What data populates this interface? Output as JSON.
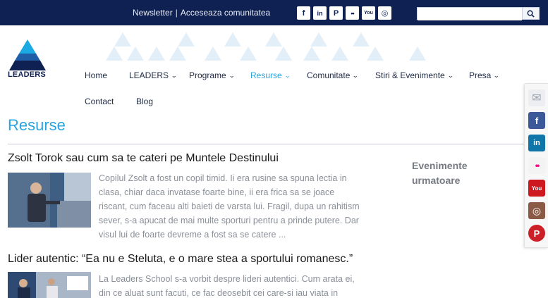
{
  "topbar": {
    "newsletter": "Newsletter",
    "separator": "|",
    "community": "Acceseaza comunitatea",
    "socials": [
      {
        "icon": "facebook-icon",
        "glyph": "f"
      },
      {
        "icon": "linkedin-icon",
        "glyph": "in"
      },
      {
        "icon": "pinterest-icon",
        "glyph": "P"
      },
      {
        "icon": "flickr-icon",
        "glyph": "••"
      },
      {
        "icon": "youtube-icon",
        "glyph": "You"
      },
      {
        "icon": "instagram-icon",
        "glyph": "◎"
      }
    ],
    "search_value": ""
  },
  "logo": {
    "text": "LEADERS",
    "colors": {
      "top": "#1aa9e1",
      "mid": "#1f5fa8",
      "bottom": "#0f2152"
    }
  },
  "nav": {
    "home": "Home",
    "leaders": "LEADERS",
    "programe": "Programe",
    "resurse": "Resurse",
    "comunitate": "Comunitate",
    "stiri": "Stiri & Evenimente",
    "presa": "Presa",
    "contact": "Contact",
    "blog": "Blog",
    "active_color": "#2aa4df"
  },
  "main": {
    "page_title": "Resurse",
    "articles": [
      {
        "title": "Zsolt Torok sau cum sa te cateri pe Muntele Destinului",
        "excerpt_lines": [
          "Copilul Zsolt  a fost un copil timid. Ii era rusine sa spuna lectia in",
          "clasa, chiar daca invatase foarte bine, ii era frica sa se joace",
          "riscant, cum faceau alti baieti de varsta lui. Fragil, dupa un rahitism",
          "sever, s-a apucat de mai multe sporturi pentru a prinde putere. Dar",
          "visul lui de foarte devreme a fost sa se catere ..."
        ]
      },
      {
        "title": "Lider autentic: “Ea nu e Steluta, e o mare stea a sportului romanesc.”",
        "excerpt_lines": [
          "La Leaders School s-a vorbit despre lideri autentici. Cum arata ei,",
          "din ce aluat sunt facuti, ce fac deosebit cei care-si iau viata in"
        ]
      }
    ]
  },
  "sidebar": {
    "heading_lines": [
      "Evenimente",
      "urmatoare"
    ]
  },
  "sharebar": [
    {
      "icon": "email-icon",
      "color": "#e9ecef",
      "glyph": "✉"
    },
    {
      "icon": "facebook-icon",
      "color": "#3b5998",
      "glyph": "f"
    },
    {
      "icon": "linkedin-icon",
      "color": "#0e76a8",
      "glyph": "in"
    },
    {
      "icon": "flickr-icon",
      "color": "#f3f3f3",
      "glyph": "••"
    },
    {
      "icon": "youtube-icon",
      "color": "#cc181e",
      "glyph": "You"
    },
    {
      "icon": "instagram-icon",
      "color": "#8a5a44",
      "glyph": "◎"
    },
    {
      "icon": "pinterest-icon",
      "color": "#cb2027",
      "glyph": "P"
    }
  ]
}
